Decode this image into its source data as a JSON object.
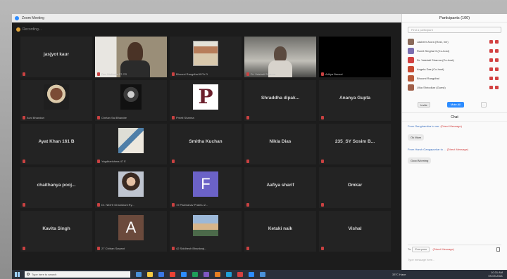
{
  "window": {
    "title": "Zoom Meeting"
  },
  "gallery": {
    "recording_label": "Recording...",
    "tiles": [
      {
        "name": "jasjyot kaur",
        "caption": "",
        "media": "name"
      },
      {
        "name": "",
        "caption": "Dev Malhotra 57 CS",
        "media": "video-man-dark"
      },
      {
        "name": "",
        "caption": "Bhoomi Rangdhal 8 Ph D",
        "media": "thumb-book"
      },
      {
        "name": "",
        "caption": "Dr. Vaishali Sharma",
        "media": "video-man-light",
        "active": true
      },
      {
        "name": "",
        "caption": "Aditya Bansal",
        "media": "video-black"
      },
      {
        "name": "",
        "caption": "Avni Bhandari",
        "media": "thumb-person"
      },
      {
        "name": "",
        "caption": "Chetan Sai Bhandre",
        "media": "thumb-robot"
      },
      {
        "name": "",
        "caption": "Preeti Sharma",
        "media": "thumb-p"
      },
      {
        "name": "Shraddha  dipak...",
        "caption": "",
        "media": "name"
      },
      {
        "name": "Ananya Gupta",
        "caption": "",
        "media": "name"
      },
      {
        "name": "Ayat Khan 161 B",
        "caption": "",
        "media": "name"
      },
      {
        "name": "",
        "caption": "Yagdharishma 47 E",
        "media": "thumb-poster"
      },
      {
        "name": "Smitha Kuchan",
        "caption": "",
        "media": "name"
      },
      {
        "name": "Nikla Dias",
        "caption": "",
        "media": "name"
      },
      {
        "name": "235_SY Sosim B...",
        "caption": "",
        "media": "name"
      },
      {
        "name": "chaithanya  pooj...",
        "caption": "",
        "media": "name"
      },
      {
        "name": "",
        "caption": "Dr. NIDHI Ghanshani Ry...",
        "media": "thumb-girl"
      },
      {
        "name": "",
        "caption": "72 Padmanav Prabhu 2...",
        "media": "letter-F"
      },
      {
        "name": "Aafiya sharif",
        "caption": "",
        "media": "name"
      },
      {
        "name": "Omkar",
        "caption": "",
        "media": "name"
      },
      {
        "name": "Kavita Singh",
        "caption": "",
        "media": "name"
      },
      {
        "name": "",
        "caption": "27 Chitran Sawant",
        "media": "letter-A"
      },
      {
        "name": "",
        "caption": "42 Siddhesh Bhardwaj...",
        "media": "thumb-sky"
      },
      {
        "name": "Ketaki naik",
        "caption": "",
        "media": "name"
      },
      {
        "name": "Vishal",
        "caption": "",
        "media": "name"
      }
    ]
  },
  "participants_panel": {
    "title": "Participants (100)",
    "search_placeholder": "Find a participant",
    "list": [
      {
        "name": "Jasbeer Arora (Host, me)",
        "color": "#8a6a5a"
      },
      {
        "name": "Rumit Singhal 3 (Co-host)",
        "color": "#7c6fb0"
      },
      {
        "name": "Dr. Vaishali Sharma (Co-host)",
        "color": "#d24141"
      },
      {
        "name": "Angela Das (Co-host)",
        "color": "#c94a32"
      },
      {
        "name": "Bhoomi Rangdhal",
        "color": "#b85a3a"
      },
      {
        "name": "Ulka Shirodkar (Guest)",
        "color": "#a0604a"
      }
    ],
    "invite_label": "Invite",
    "mute_all_label": "Mute All",
    "more_label": "..."
  },
  "chat": {
    "title": "Chat",
    "messages": [
      {
        "from": "From Sanghamitra to me:",
        "to": "(Direct Message)",
        "text": "Ok Mam"
      },
      {
        "from": "From Harsh Gangapurkar to ...",
        "to": "(Direct Message)",
        "text": "Good Morning"
      }
    ],
    "to_label": "To:",
    "to_select": "Everyone",
    "to_note": "(Direct Message)",
    "type_placeholder": "Type message here..."
  },
  "taskbar": {
    "search_placeholder": "Type here to search",
    "weather": "33°C  Haze",
    "time": "10:31 AM",
    "date": "09-09-2021",
    "apps": [
      "#4a90d9",
      "#f5c842",
      "#3b78e7",
      "#e94235",
      "#2d8cff",
      "#1e9e5a",
      "#7e57c2",
      "#e67e22",
      "#20a0d8",
      "#d24141",
      "#2d8cff",
      "#4a90d9"
    ]
  }
}
